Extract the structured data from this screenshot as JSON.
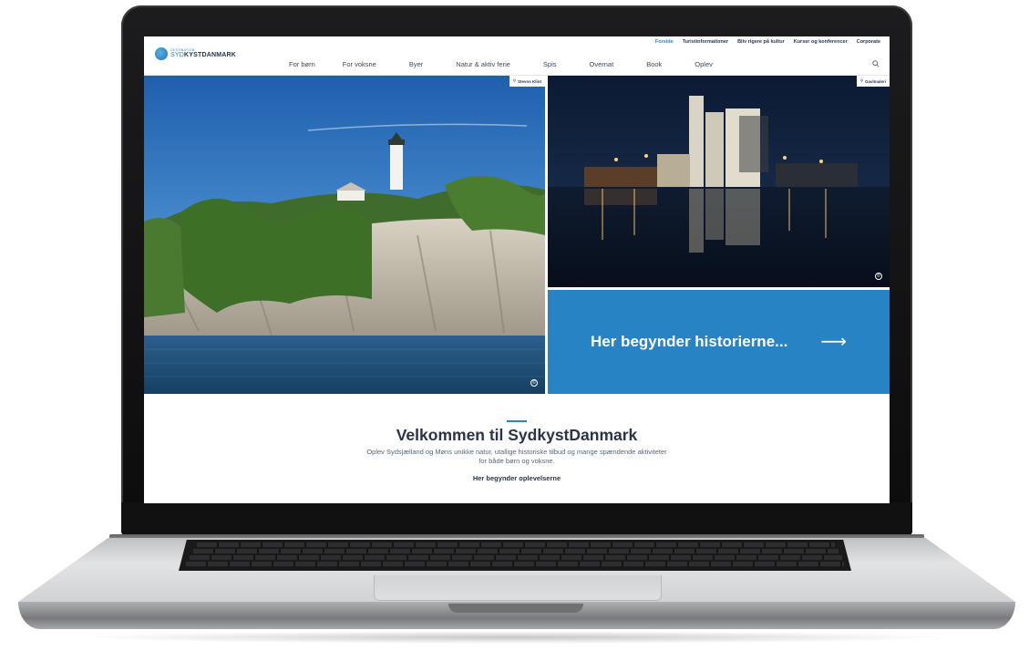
{
  "site": {
    "logo": {
      "small": "DESTINATION",
      "prefix": "SYD",
      "main": "KYSTDANMARK"
    },
    "utility_nav": [
      {
        "label": "Forside",
        "active": true
      },
      {
        "label": "Turistinformationer",
        "active": false
      },
      {
        "label": "Bliv rigere på kultur",
        "active": false
      },
      {
        "label": "Kurser og konferencer",
        "active": false
      },
      {
        "label": "Corporate",
        "active": false
      }
    ],
    "main_nav": [
      "For børn",
      "For voksne",
      "Byer",
      "Natur & aktiv ferie",
      "Spis",
      "Overnat",
      "Book",
      "Oplev"
    ],
    "search_icon": "search-icon"
  },
  "hero": {
    "left_tag": "Stevns Klint",
    "right_tag": "Gavlmaleri",
    "copyright_symbol": "©",
    "cta_text": "Her begynder historierne...",
    "cta_arrow": "⟶"
  },
  "welcome": {
    "title": "Velkommen til SydkystDanmark",
    "text": "Oplev Sydsjælland og Møns unikke natur, utallige historiske tilbud og mange spændende aktiviteter for både børn og voksne.",
    "link": "Her begynder oplevelserne"
  },
  "colors": {
    "accent": "#2783c4",
    "heading": "#2a3446"
  }
}
